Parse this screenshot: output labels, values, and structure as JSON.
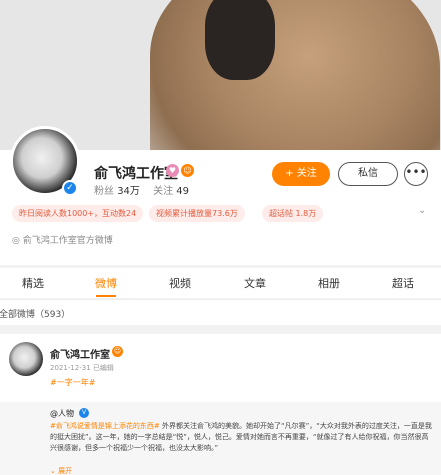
{
  "profile": {
    "name": "俞飞鸿工作室",
    "fans_label": "粉丝",
    "fans_value": "34万",
    "following_label": "关注",
    "following_value": "49",
    "follow_label": "+ 关注",
    "message_label": "私信",
    "more_label": "•••",
    "tags": [
      "昨日阅读人数1000+，互动数24",
      "视频累计播放量73.6万",
      "超话帖 1.8万"
    ],
    "tags_more": "⌄",
    "official": "俞飞鸿工作室官方微博"
  },
  "tabs": [
    "精选",
    "微博",
    "视频",
    "文章",
    "相册",
    "超话"
  ],
  "all_posts": "全部微博（593）",
  "post": {
    "author": "俞飞鸿工作室",
    "date": "2021-12-31",
    "edited": "已编辑",
    "topic": "#一字一年#",
    "repost": {
      "user": "@人物",
      "text_highlight": "#俞飞鸿说爱情是锦上添花的东西#",
      "text_body": " 外界都关注俞飞鸿的美貌。她却开始了“凡尔赛”，“大众对我外表的过度关注，一直是我的挺大困扰”。这一年，她的一字总结是“悦”，悦人，悦己。爱情对她而言不再重要，“就像过了有人给你祝福，你当然很高兴很感谢，但多一个祝福少一个祝福，也没太大影响。”",
      "more": "⌄ 展开"
    }
  },
  "colors": {
    "accent": "#ff8200",
    "verify_blue": "#1b85ea"
  }
}
